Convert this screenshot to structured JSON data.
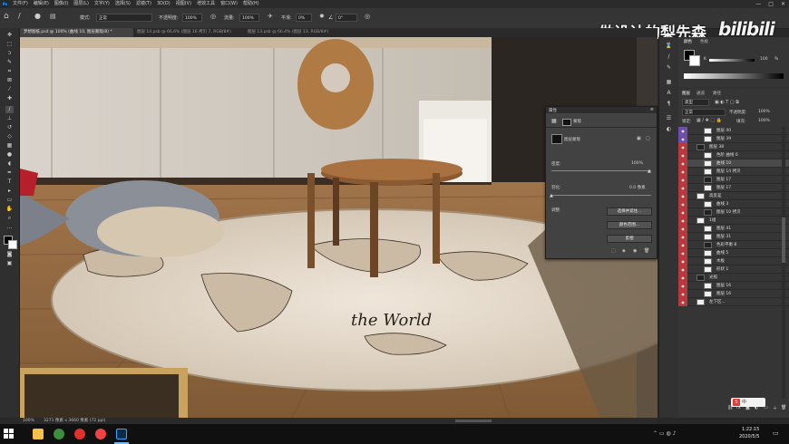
{
  "menubar": {
    "app_logo": "Ps",
    "items": [
      "文件(F)",
      "编辑(E)",
      "图像(I)",
      "图层(L)",
      "文字(Y)",
      "选择(S)",
      "滤镜(T)",
      "3D(D)",
      "视图(V)",
      "增效工具",
      "窗口(W)",
      "帮助(H)"
    ],
    "window_controls": [
      "—",
      "□",
      "✕"
    ]
  },
  "options": {
    "mode_label": "模式:",
    "mode_value": "正常",
    "opacity_label": "不透明度:",
    "opacity_value": "100%",
    "flow_label": "流量:",
    "flow_value": "100%",
    "smooth_label": "平滑:",
    "smooth_value": "0%",
    "angle_value": "0°"
  },
  "watermark": {
    "author": "做设计的梨先森",
    "logo": "bilibili"
  },
  "tabs": [
    {
      "label": "梦想图纸.psd @ 100% (曲线 10, 图层蒙版/8) *"
    },
    {
      "label": "图层 14.psb @ 66.6% (图层 16 拷贝 7, RGB/8#)"
    },
    {
      "label": "图层 13.psb @ 66.4% (图层 13, RGB/8#)"
    }
  ],
  "status": {
    "zoom": "100%",
    "doc": "3271 像素 x 3660 像素 (72 ppi)"
  },
  "properties": {
    "title": "属性",
    "section": "蒙版",
    "mask_label": "图层蒙版",
    "density_label": "密度:",
    "density_value": "100%",
    "feather_label": "羽化:",
    "feather_value": "0.0 像素",
    "adjust_label": "调整:",
    "btn_select_subject": "选择并遮住...",
    "btn_color_range": "颜色范围...",
    "btn_invert": "反相"
  },
  "color_panel": {
    "tabs": [
      "颜色",
      "色板"
    ],
    "k_label": "K",
    "k_value": "100",
    "k_unit": "%"
  },
  "layers_panel": {
    "tabs": [
      "图层",
      "通道",
      "路径"
    ],
    "kind_label": "类型",
    "blend_mode": "正常",
    "opacity_label": "不透明度:",
    "opacity_value": "100%",
    "lock_label": "锁定:",
    "fill_label": "填充:",
    "fill_value": "100%",
    "layers": [
      {
        "name": "图层 40",
        "eye": "purple",
        "indent": 2
      },
      {
        "name": "图层 39",
        "eye": "purple",
        "indent": 2
      },
      {
        "name": "图层 38",
        "eye": "red",
        "indent": 1
      },
      {
        "name": "色阶 曲线 6",
        "eye": "red",
        "indent": 2
      },
      {
        "name": "曲线 10",
        "eye": "red",
        "indent": 2,
        "selected": true
      },
      {
        "name": "图层 14 拷贝",
        "eye": "red",
        "indent": 2
      },
      {
        "name": "图层 17",
        "eye": "red",
        "indent": 2
      },
      {
        "name": "图层 17",
        "eye": "red",
        "indent": 2
      },
      {
        "name": "高反差",
        "eye": "red",
        "indent": 1
      },
      {
        "name": "曲线 3",
        "eye": "red",
        "indent": 2
      },
      {
        "name": "图层 10 拷贝",
        "eye": "red",
        "indent": 2
      },
      {
        "name": "1组",
        "eye": "red",
        "indent": 1
      },
      {
        "name": "图层 41",
        "eye": "red",
        "indent": 2
      },
      {
        "name": "图层 31",
        "eye": "red",
        "indent": 2
      },
      {
        "name": "色彩平衡 8",
        "eye": "red",
        "indent": 2
      },
      {
        "name": "曲线 5",
        "eye": "red",
        "indent": 2
      },
      {
        "name": "木板",
        "eye": "red",
        "indent": 2
      },
      {
        "name": "形状 1",
        "eye": "red",
        "indent": 2
      },
      {
        "name": "光照",
        "eye": "red",
        "indent": 1
      },
      {
        "name": "图层 16",
        "eye": "red",
        "indent": 2
      },
      {
        "name": "图层 16",
        "eye": "red",
        "indent": 2
      },
      {
        "name": "左下区...",
        "eye": "red",
        "indent": 1
      }
    ]
  },
  "taskbar": {
    "time": "1:22:15",
    "date": "2020/5/5",
    "ime": "中"
  }
}
